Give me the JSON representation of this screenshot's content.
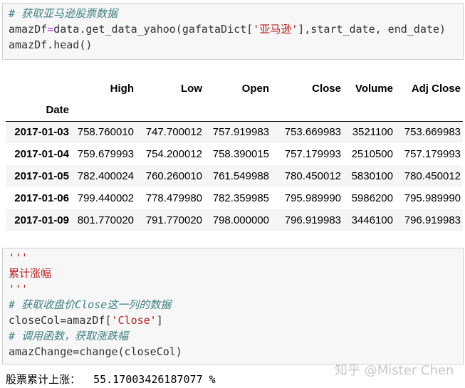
{
  "cell1": {
    "comment": "# 获取亚马逊股票数据",
    "line2": {
      "var": "amazDf",
      "eq": "=",
      "call_a": "data.get_data_yahoo(gafataDict[",
      "key": "'亚马逊'",
      "call_b": "],start_date, end_date)"
    },
    "line3": "amazDf.head()"
  },
  "dataframe": {
    "columns": [
      "High",
      "Low",
      "Open",
      "Close",
      "Volume",
      "Adj Close"
    ],
    "index_name": "Date",
    "rows": [
      {
        "date": "2017-01-03",
        "values": [
          "758.760010",
          "747.700012",
          "757.919983",
          "753.669983",
          "3521100",
          "753.669983"
        ]
      },
      {
        "date": "2017-01-04",
        "values": [
          "759.679993",
          "754.200012",
          "758.390015",
          "757.179993",
          "2510500",
          "757.179993"
        ]
      },
      {
        "date": "2017-01-05",
        "values": [
          "782.400024",
          "760.260010",
          "761.549988",
          "780.450012",
          "5830100",
          "780.450012"
        ]
      },
      {
        "date": "2017-01-06",
        "values": [
          "799.440002",
          "778.479980",
          "782.359985",
          "795.989990",
          "5986200",
          "795.989990"
        ]
      },
      {
        "date": "2017-01-09",
        "values": [
          "801.770020",
          "791.770020",
          "798.000000",
          "796.919983",
          "3446100",
          "796.919983"
        ]
      }
    ]
  },
  "cell2": {
    "doc_open": "'''",
    "doc_text": "累计涨幅",
    "doc_close": "'''",
    "comment1": "# 获取收盘价Close这一列的数据",
    "line_close_a": "closeCol=amazDf[",
    "line_close_key": "'Close'",
    "line_close_b": "]",
    "comment2": "# 调用函数，获取涨跌幅",
    "line_change": "amazChange=change(closeCol)"
  },
  "output": {
    "label": "股票累计上涨：",
    "value": "55.17003426187077 %"
  },
  "watermark": "知乎 @Mister Chen"
}
